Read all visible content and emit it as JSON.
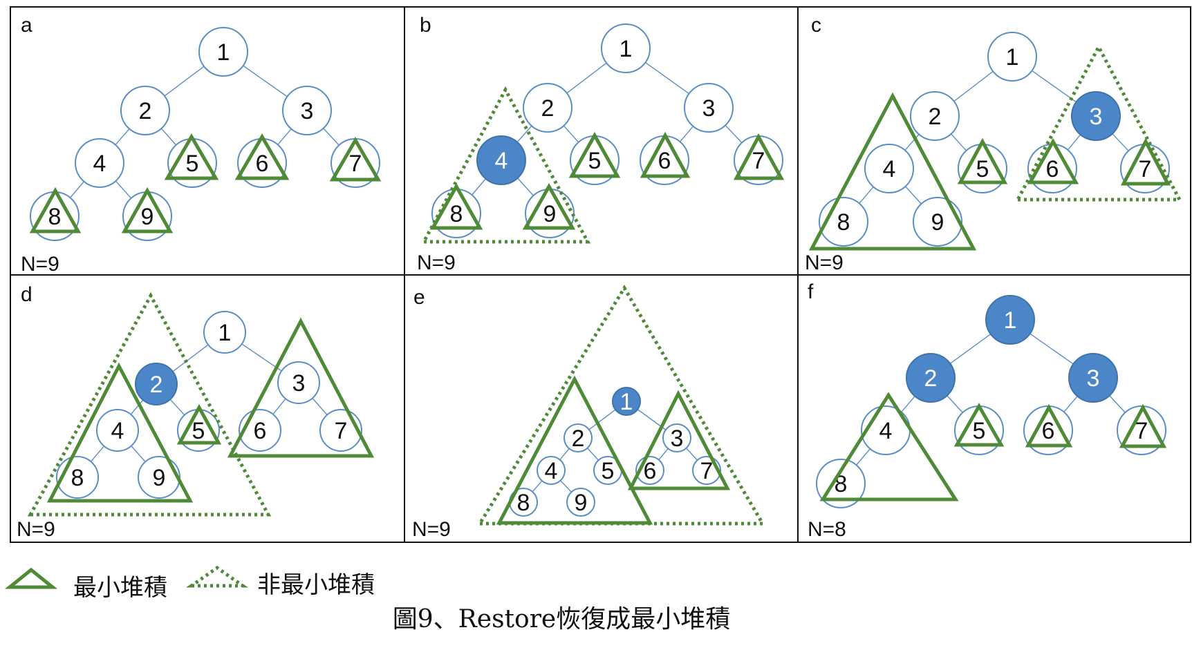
{
  "colors": {
    "node_stroke": "#5b8ec4",
    "node_highlight": "#4a86c8",
    "triangle": "#4f8a37",
    "frame": "#111111"
  },
  "panels": [
    {
      "letter": "a",
      "count": "N=9",
      "nodes": [
        {
          "label": "1",
          "hl": false
        },
        {
          "label": "2",
          "hl": false
        },
        {
          "label": "3",
          "hl": false
        },
        {
          "label": "4",
          "hl": false
        },
        {
          "label": "5",
          "hl": false
        },
        {
          "label": "6",
          "hl": false
        },
        {
          "label": "7",
          "hl": false
        },
        {
          "label": "8",
          "hl": false
        },
        {
          "label": "9",
          "hl": false
        }
      ],
      "edges": [
        [
          0,
          1
        ],
        [
          0,
          2
        ],
        [
          1,
          3
        ],
        [
          1,
          4
        ],
        [
          2,
          5
        ],
        [
          2,
          6
        ],
        [
          3,
          7
        ],
        [
          3,
          8
        ]
      ],
      "heaps": [
        {
          "root": "5",
          "style": "solid"
        },
        {
          "root": "6",
          "style": "solid"
        },
        {
          "root": "7",
          "style": "solid"
        },
        {
          "root": "8",
          "style": "solid"
        },
        {
          "root": "9",
          "style": "solid"
        }
      ]
    },
    {
      "letter": "b",
      "count": "N=9",
      "nodes": [
        {
          "label": "1",
          "hl": false
        },
        {
          "label": "2",
          "hl": false
        },
        {
          "label": "3",
          "hl": false
        },
        {
          "label": "4",
          "hl": true
        },
        {
          "label": "5",
          "hl": false
        },
        {
          "label": "6",
          "hl": false
        },
        {
          "label": "7",
          "hl": false
        },
        {
          "label": "8",
          "hl": false
        },
        {
          "label": "9",
          "hl": false
        }
      ],
      "edges": [
        [
          0,
          1
        ],
        [
          0,
          2
        ],
        [
          1,
          3
        ],
        [
          1,
          4
        ],
        [
          2,
          5
        ],
        [
          2,
          6
        ],
        [
          3,
          7
        ],
        [
          3,
          8
        ]
      ],
      "heaps": [
        {
          "root": "4",
          "style": "dotted"
        },
        {
          "root": "5",
          "style": "solid"
        },
        {
          "root": "6",
          "style": "solid"
        },
        {
          "root": "7",
          "style": "solid"
        },
        {
          "root": "8",
          "style": "solid"
        },
        {
          "root": "9",
          "style": "solid"
        }
      ]
    },
    {
      "letter": "c",
      "count": "N=9",
      "nodes": [
        {
          "label": "1",
          "hl": false
        },
        {
          "label": "2",
          "hl": false
        },
        {
          "label": "3",
          "hl": true
        },
        {
          "label": "4",
          "hl": false
        },
        {
          "label": "5",
          "hl": false
        },
        {
          "label": "6",
          "hl": false
        },
        {
          "label": "7",
          "hl": false
        },
        {
          "label": "8",
          "hl": false
        },
        {
          "label": "9",
          "hl": false
        }
      ],
      "edges": [
        [
          0,
          1
        ],
        [
          0,
          2
        ],
        [
          1,
          3
        ],
        [
          1,
          4
        ],
        [
          2,
          5
        ],
        [
          2,
          6
        ],
        [
          3,
          7
        ],
        [
          3,
          8
        ]
      ],
      "heaps": [
        {
          "root": "4",
          "style": "solid"
        },
        {
          "root": "3",
          "style": "dotted"
        },
        {
          "root": "5",
          "style": "solid"
        },
        {
          "root": "6",
          "style": "solid"
        },
        {
          "root": "7",
          "style": "solid"
        }
      ]
    },
    {
      "letter": "d",
      "count": "N=9",
      "nodes": [
        {
          "label": "1",
          "hl": false
        },
        {
          "label": "2",
          "hl": true
        },
        {
          "label": "3",
          "hl": false
        },
        {
          "label": "4",
          "hl": false
        },
        {
          "label": "5",
          "hl": false
        },
        {
          "label": "6",
          "hl": false
        },
        {
          "label": "7",
          "hl": false
        },
        {
          "label": "8",
          "hl": false
        },
        {
          "label": "9",
          "hl": false
        }
      ],
      "edges": [
        [
          0,
          1
        ],
        [
          0,
          2
        ],
        [
          1,
          3
        ],
        [
          1,
          4
        ],
        [
          2,
          5
        ],
        [
          2,
          6
        ],
        [
          3,
          7
        ],
        [
          3,
          8
        ]
      ],
      "heaps": [
        {
          "root": "2",
          "style": "dotted"
        },
        {
          "root": "4",
          "style": "solid"
        },
        {
          "root": "3",
          "style": "solid"
        },
        {
          "root": "5",
          "style": "solid"
        }
      ]
    },
    {
      "letter": "e",
      "count": "N=9",
      "nodes": [
        {
          "label": "1",
          "hl": true
        },
        {
          "label": "2",
          "hl": false
        },
        {
          "label": "3",
          "hl": false
        },
        {
          "label": "4",
          "hl": false
        },
        {
          "label": "5",
          "hl": false
        },
        {
          "label": "6",
          "hl": false
        },
        {
          "label": "7",
          "hl": false
        },
        {
          "label": "8",
          "hl": false
        },
        {
          "label": "9",
          "hl": false
        }
      ],
      "edges": [
        [
          0,
          1
        ],
        [
          0,
          2
        ],
        [
          1,
          3
        ],
        [
          1,
          4
        ],
        [
          2,
          5
        ],
        [
          2,
          6
        ],
        [
          3,
          7
        ],
        [
          3,
          8
        ]
      ],
      "heaps": [
        {
          "root": "1",
          "style": "dotted"
        },
        {
          "root": "2",
          "style": "solid"
        },
        {
          "root": "3",
          "style": "solid"
        }
      ]
    },
    {
      "letter": "f",
      "count": "N=8",
      "nodes": [
        {
          "label": "1",
          "hl": true
        },
        {
          "label": "2",
          "hl": true
        },
        {
          "label": "3",
          "hl": true
        },
        {
          "label": "4",
          "hl": false
        },
        {
          "label": "5",
          "hl": false
        },
        {
          "label": "6",
          "hl": false
        },
        {
          "label": "7",
          "hl": false
        },
        {
          "label": "8",
          "hl": false
        }
      ],
      "edges": [
        [
          0,
          1
        ],
        [
          0,
          2
        ],
        [
          1,
          3
        ],
        [
          1,
          4
        ],
        [
          2,
          5
        ],
        [
          2,
          6
        ],
        [
          3,
          7
        ]
      ],
      "heaps": [
        {
          "root": "4",
          "style": "solid"
        },
        {
          "root": "5",
          "style": "solid"
        },
        {
          "root": "6",
          "style": "solid"
        },
        {
          "root": "7",
          "style": "solid"
        }
      ]
    }
  ],
  "legend": {
    "solid_label": "最小堆積",
    "dotted_label": "非最小堆積"
  },
  "caption": "圖9、Restore恢復成最小堆積"
}
